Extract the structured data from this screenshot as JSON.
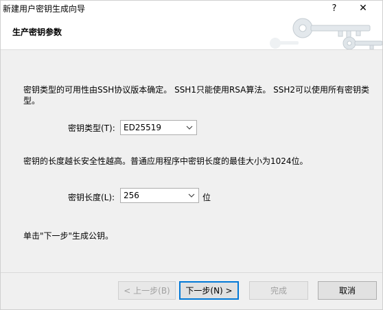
{
  "window": {
    "title": "新建用户密钥生成向导",
    "help_glyph": "?",
    "close_glyph": "✕"
  },
  "header": {
    "title": "生产密钥参数"
  },
  "content": {
    "intro_text": "密钥类型的可用性由SSH协议版本确定。 SSH1只能使用RSA算法。 SSH2可以使用所有密钥类型。",
    "key_type": {
      "label": "密钥类型(T):",
      "value": "ED25519"
    },
    "length_text": "密钥的长度越长安全性越高。普通应用程序中密钥长度的最佳大小为1024位。",
    "key_length": {
      "label": "密钥长度(L):",
      "value": "256",
      "unit": "位"
    },
    "hint_text": "单击\"下一步\"生成公钥。"
  },
  "footer": {
    "back_label": "< 上一步(B)",
    "next_label": "下一步(N) >",
    "finish_label": "完成",
    "cancel_label": "取消"
  },
  "icons": {
    "header_art": "keys-icon",
    "dropdown": "chevron-down-icon"
  }
}
